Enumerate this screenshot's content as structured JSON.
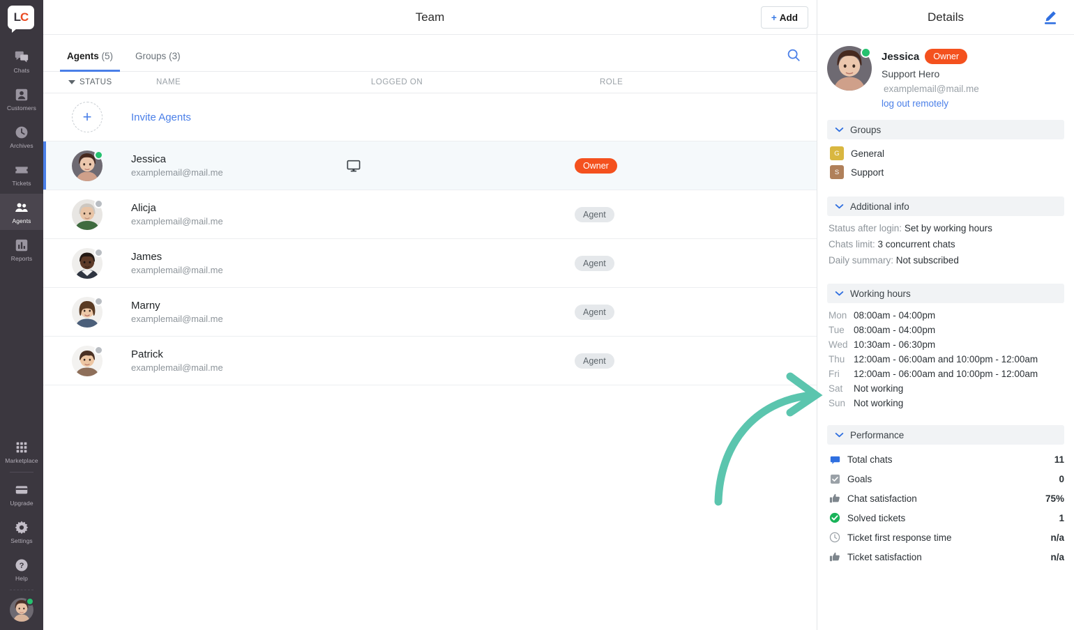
{
  "colors": {
    "accent_blue": "#4a7fe8",
    "owner_badge": "#f4511e",
    "online_green": "#25c16f",
    "arrow_teal": "#5bc5ae",
    "nav_bg": "#3b373f",
    "group_general": "#d9b740",
    "group_support": "#b0805a"
  },
  "nav": {
    "logo": {
      "left": "L",
      "right": "C",
      "name": "livechat-logo"
    },
    "items": [
      {
        "label": "Chats",
        "icon": "chats-icon",
        "active": false
      },
      {
        "label": "Customers",
        "icon": "customers-icon",
        "active": false
      },
      {
        "label": "Archives",
        "icon": "archives-icon",
        "active": false
      },
      {
        "label": "Tickets",
        "icon": "tickets-icon",
        "active": false
      },
      {
        "label": "Agents",
        "icon": "agents-icon",
        "active": true
      },
      {
        "label": "Reports",
        "icon": "reports-icon",
        "active": false
      }
    ],
    "bottom_items": [
      {
        "label": "Marketplace",
        "icon": "marketplace-icon"
      },
      {
        "label": "Upgrade",
        "icon": "upgrade-icon"
      },
      {
        "label": "Settings",
        "icon": "gear-icon"
      },
      {
        "label": "Help",
        "icon": "help-icon"
      }
    ]
  },
  "main": {
    "title": "Team",
    "add_button": {
      "plus": "+",
      "label": "Add"
    },
    "tabs": [
      {
        "label": "Agents",
        "count": "(5)",
        "active": true
      },
      {
        "label": "Groups",
        "count": "(3)",
        "active": false
      }
    ],
    "search_icon": "search-icon",
    "columns": {
      "status": "STATUS",
      "name": "NAME",
      "logged_on": "LOGGED ON",
      "role": "ROLE"
    },
    "invite_row": {
      "label": "Invite Agents",
      "icon": "plus-icon"
    },
    "rows": [
      {
        "name": "Jessica",
        "email": "examplemail@mail.me",
        "status": "online",
        "logged_on": "desktop-monitor-icon",
        "role": "Owner",
        "role_type": "owner",
        "selected": true
      },
      {
        "name": "Alicja",
        "email": "examplemail@mail.me",
        "status": "offline",
        "logged_on": "",
        "role": "Agent",
        "role_type": "agent",
        "selected": false
      },
      {
        "name": "James",
        "email": "examplemail@mail.me",
        "status": "offline",
        "logged_on": "",
        "role": "Agent",
        "role_type": "agent",
        "selected": false
      },
      {
        "name": "Marny",
        "email": "examplemail@mail.me",
        "status": "offline",
        "logged_on": "",
        "role": "Agent",
        "role_type": "agent",
        "selected": false
      },
      {
        "name": "Patrick",
        "email": "examplemail@mail.me",
        "status": "offline",
        "logged_on": "",
        "role": "Agent",
        "role_type": "agent",
        "selected": false
      }
    ]
  },
  "details": {
    "title": "Details",
    "edit_icon": "edit-pencil-icon",
    "profile": {
      "name": "Jessica",
      "badge": "Owner",
      "job_title": "Support Hero",
      "email": "examplemail@mail.me",
      "logout_link": "log out remotely",
      "status": "online"
    },
    "groups_section": {
      "title": "Groups",
      "items": [
        {
          "initial": "G",
          "name": "General",
          "color": "#d9b740"
        },
        {
          "initial": "S",
          "name": "Support",
          "color": "#b0805a"
        }
      ]
    },
    "additional_info": {
      "title": "Additional info",
      "rows": [
        {
          "label": "Status after login:",
          "value": "Set by working hours"
        },
        {
          "label": "Chats limit:",
          "value": "3 concurrent chats"
        },
        {
          "label": "Daily summary:",
          "value": "Not subscribed"
        }
      ]
    },
    "working_hours": {
      "title": "Working hours",
      "rows": [
        {
          "day": "Mon",
          "value": "08:00am - 04:00pm"
        },
        {
          "day": "Tue",
          "value": "08:00am - 04:00pm"
        },
        {
          "day": "Wed",
          "value": "10:30am - 06:30pm"
        },
        {
          "day": "Thu",
          "value": "12:00am - 06:00am and 10:00pm - 12:00am"
        },
        {
          "day": "Fri",
          "value": "12:00am - 06:00am and 10:00pm - 12:00am"
        },
        {
          "day": "Sat",
          "value": "Not working"
        },
        {
          "day": "Sun",
          "value": "Not working"
        }
      ]
    },
    "performance": {
      "title": "Performance",
      "rows": [
        {
          "icon": "chat-bubble-icon",
          "label": "Total chats",
          "value": "11"
        },
        {
          "icon": "checkbox-icon",
          "label": "Goals",
          "value": "0"
        },
        {
          "icon": "thumbs-up-icon",
          "label": "Chat satisfaction",
          "value": "75%"
        },
        {
          "icon": "check-circle-icon",
          "label": "Solved tickets",
          "value": "1"
        },
        {
          "icon": "clock-icon",
          "label": "Ticket first response time",
          "value": "n/a"
        },
        {
          "icon": "thumbs-up-icon",
          "label": "Ticket satisfaction",
          "value": "n/a"
        }
      ]
    }
  },
  "annotation": {
    "arrow": "curved-arrow-annotation",
    "color": "#5bc5ae"
  }
}
